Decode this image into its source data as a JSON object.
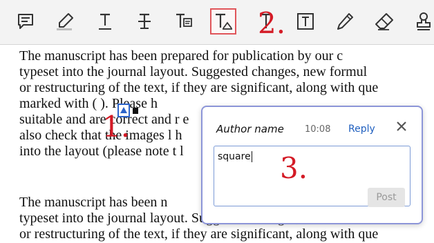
{
  "toolbar": {
    "tools": [
      {
        "icon": "comment-icon"
      },
      {
        "icon": "highlight-icon"
      },
      {
        "icon": "underline-text-icon"
      },
      {
        "icon": "strikethrough-text-icon"
      },
      {
        "icon": "replace-text-icon"
      },
      {
        "icon": "insert-text-comment-icon",
        "selected": true
      },
      {
        "icon": "text-icon"
      },
      {
        "icon": "text-box-icon"
      },
      {
        "icon": "pencil-icon"
      },
      {
        "icon": "eraser-icon"
      },
      {
        "icon": "stamp-icon"
      }
    ]
  },
  "steps": {
    "one": "1.",
    "two": "2.",
    "three": "3."
  },
  "document": {
    "lines": [
      "The manuscript has been prepared for publication by our c",
      "typeset into the journal layout. Suggested changes, new formul",
      "or restructuring of the text, if they are significant, along with que",
      "marked with (      ). Please                                                       h",
      "suitable and are correct and r                                                    e",
      "also check that the images l                                                       h",
      "into the layout (please note t                                                     l",
      "",
      "The manuscript has been                                                            n",
      "typeset into the journal layout. Suggested changes, new formul",
      "or restructuring of the text, if they are significant, along with que"
    ]
  },
  "comment_popup": {
    "author": "Author name",
    "time": "10:08",
    "reply_label": "Reply",
    "text_value": "square",
    "post_label": "Post"
  },
  "colors": {
    "accent": "#d41b26",
    "popup_border": "#8c95d8",
    "link": "#1f5fbf"
  }
}
